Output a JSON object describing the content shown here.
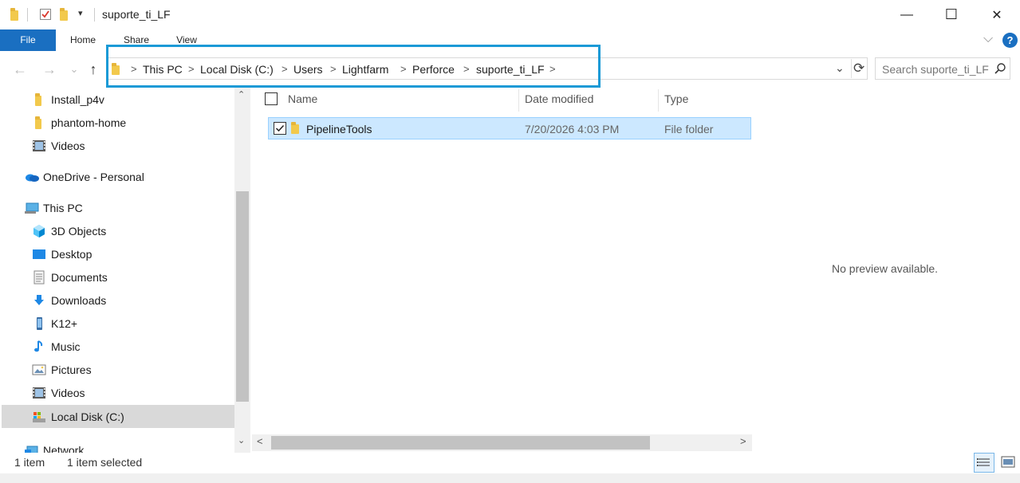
{
  "window": {
    "title": "suporte_ti_LF",
    "minimize": "—",
    "maximize": "☐",
    "close": "✕"
  },
  "ribbon": {
    "tabs": [
      "File",
      "Home",
      "Share",
      "View"
    ],
    "collapse": "⌵",
    "help": "?"
  },
  "navigation": {
    "back": "←",
    "forward": "→",
    "recent": "⌄",
    "up": "↑"
  },
  "address": {
    "crumbs": [
      "This PC",
      "Local Disk (C:)",
      "Users",
      "Lightfarm",
      "Perforce",
      "suporte_ti_LF"
    ],
    "separator": ">",
    "dropdown": "⌄",
    "refresh": "⟳"
  },
  "search": {
    "placeholder": "Search suporte_ti_LF"
  },
  "sidebar": {
    "items": [
      {
        "label": "Install_p4v",
        "icon": "folder-icon"
      },
      {
        "label": "phantom-home",
        "icon": "folder-icon"
      },
      {
        "label": "Videos",
        "icon": "videos-icon"
      },
      {
        "label": "OneDrive - Personal",
        "icon": "onedrive-icon"
      },
      {
        "label": "This PC",
        "icon": "this-pc-icon"
      },
      {
        "label": "3D Objects",
        "icon": "3d-objects-icon"
      },
      {
        "label": "Desktop",
        "icon": "desktop-icon"
      },
      {
        "label": "Documents",
        "icon": "documents-icon"
      },
      {
        "label": "Downloads",
        "icon": "downloads-icon"
      },
      {
        "label": "K12+",
        "icon": "phone-icon"
      },
      {
        "label": "Music",
        "icon": "music-icon"
      },
      {
        "label": "Pictures",
        "icon": "pictures-icon"
      },
      {
        "label": "Videos",
        "icon": "videos-icon"
      },
      {
        "label": "Local Disk (C:)",
        "icon": "local-disk-icon"
      },
      {
        "label": "Network",
        "icon": "network-icon"
      }
    ]
  },
  "filelist": {
    "columns": [
      "Name",
      "Date modified",
      "Type"
    ],
    "rows": [
      {
        "name": "PipelineTools",
        "date": "7/20/2026 4:03 PM",
        "type": "File folder",
        "selected": true
      }
    ]
  },
  "preview": {
    "message": "No preview available."
  },
  "status": {
    "count": "1 item",
    "selected": "1 item selected"
  },
  "colors": {
    "accent": "#1a6fc1",
    "highlight_border": "#1b9ad6",
    "selection": "#cce8ff"
  }
}
